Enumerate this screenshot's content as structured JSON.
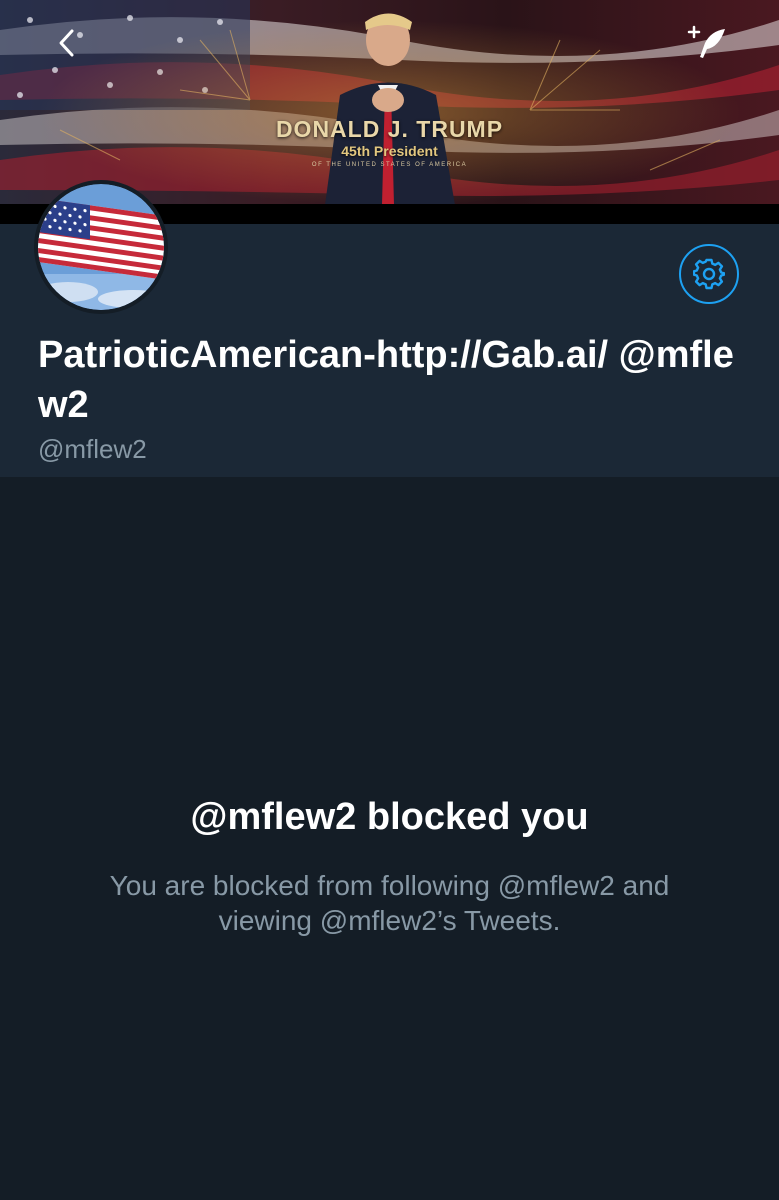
{
  "header": {
    "banner_title": "DONALD J. TRUMP",
    "banner_subtitle": "45th President",
    "banner_tagline": "OF THE UNITED STATES OF AMERICA",
    "back_icon": "chevron-left-icon",
    "compose_icon": "compose-tweet-icon"
  },
  "profile": {
    "display_name": "PatrioticAmerican-http://Gab.ai/ @mflew2",
    "handle": "@mflew2",
    "avatar": "american-flag-avatar",
    "settings_icon": "gear-icon"
  },
  "blocked": {
    "title": "@mflew2 blocked you",
    "body": "You are blocked from following @mflew2 and viewing @mflew2’s Tweets."
  },
  "colors": {
    "background": "#141d26",
    "panel": "#1b2836",
    "accent": "#1da1f2",
    "secondary_text": "#8899a6"
  }
}
